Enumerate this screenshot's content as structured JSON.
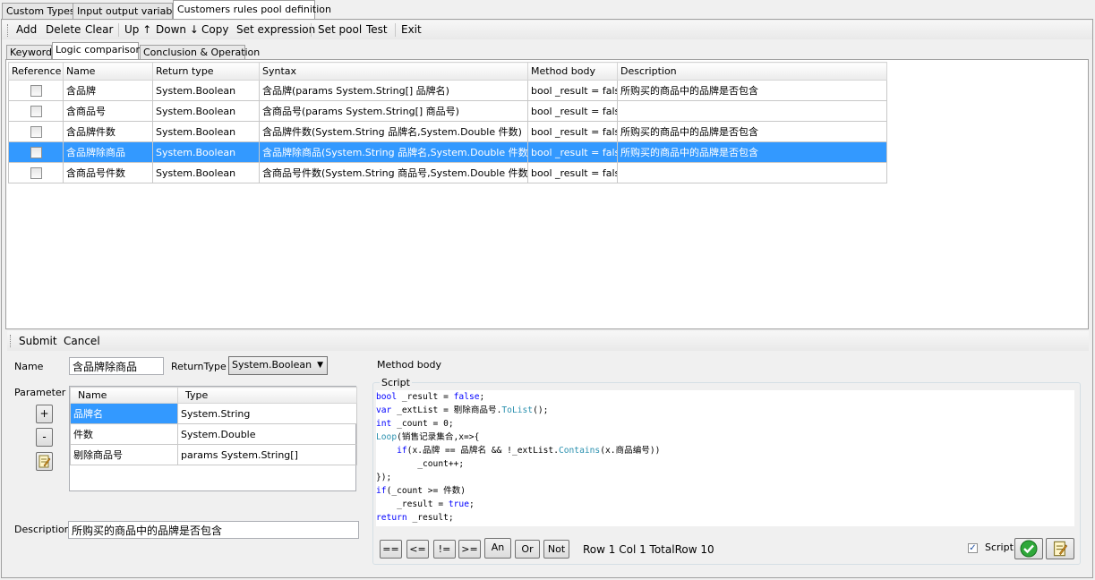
{
  "outer_tabs": [
    "Custom Types",
    "Input output variables",
    "Customers rules pool  definition"
  ],
  "toolbar": {
    "items": [
      "Add",
      "Delete",
      "Clear",
      "Up ↑",
      "Down ↓",
      "Copy",
      "Set expression",
      "Set pool",
      "Test",
      "Exit"
    ]
  },
  "inner_tabs": [
    "Keyword",
    "Logic comparison",
    "Conclusion & Operation"
  ],
  "grid": {
    "headers": [
      "Reference",
      "Name",
      "Return type",
      "Syntax",
      "Method body",
      "Description"
    ],
    "rows": [
      {
        "name": "含品牌",
        "return_type": "System.Boolean",
        "syntax": "含品牌(params System.String[] 品牌名)",
        "body": "bool _result = fals...",
        "desc": "所购买的商品中的品牌是否包含"
      },
      {
        "name": "含商品号",
        "return_type": "System.Boolean",
        "syntax": "含商品号(params System.String[] 商品号)",
        "body": "bool _result = fals...",
        "desc": ""
      },
      {
        "name": "含品牌件数",
        "return_type": "System.Boolean",
        "syntax": "含品牌件数(System.String 品牌名,System.Double 件数)",
        "body": "bool _result = fals...",
        "desc": "所购买的商品中的品牌是否包含"
      },
      {
        "name": "含品牌除商品",
        "return_type": "System.Boolean",
        "syntax": "含品牌除商品(System.String 品牌名,System.Double 件数,...",
        "body": "bool _result = fals...",
        "desc": "所购买的商品中的品牌是否包含"
      },
      {
        "name": "含商品号件数",
        "return_type": "System.Boolean",
        "syntax": "含商品号件数(System.String 商品号,System.Double 件数)",
        "body": "bool _result = fals...",
        "desc": ""
      }
    ]
  },
  "editor_bar": {
    "submit": "Submit",
    "cancel": "Cancel"
  },
  "form": {
    "name_label": "Name",
    "name_value": "含品牌除商品",
    "return_type_label": "ReturnType",
    "return_type_value": "System.Boolean",
    "parameter_label": "Parameter",
    "param_headers": [
      "Name",
      "Type"
    ],
    "params": [
      {
        "name": "品牌名",
        "type": "System.String"
      },
      {
        "name": "件数",
        "type": "System.Double"
      },
      {
        "name": "剔除商品号",
        "type": "params System.String[]"
      }
    ],
    "add_btn": "+",
    "remove_btn": "-",
    "description_label": "Description",
    "description_value": "所购买的商品中的品牌是否包含"
  },
  "method": {
    "label": "Method body",
    "script_group": "Script",
    "code_lines": [
      "bool _result = false;",
      "var _extList = 剔除商品号.ToList();",
      "int _count = 0;",
      "Loop(销售记录集合,x=>{",
      "    if(x.品牌 == 品牌名 && !_extList.Contains(x.商品编号))",
      "        _count++;",
      "});",
      "if(_count >= 件数)",
      "    _result = true;",
      "return _result;"
    ],
    "op_buttons": [
      "==",
      "<=",
      "!=",
      ">=",
      "An",
      "Or",
      "Not"
    ],
    "status": "Row 1 Col 1  TotalRow 10",
    "script_check_label": "Script",
    "script_checked": true
  },
  "colors": {
    "selection": "#3399ff",
    "keyword": "#0000ff",
    "type": "#2b91af"
  }
}
